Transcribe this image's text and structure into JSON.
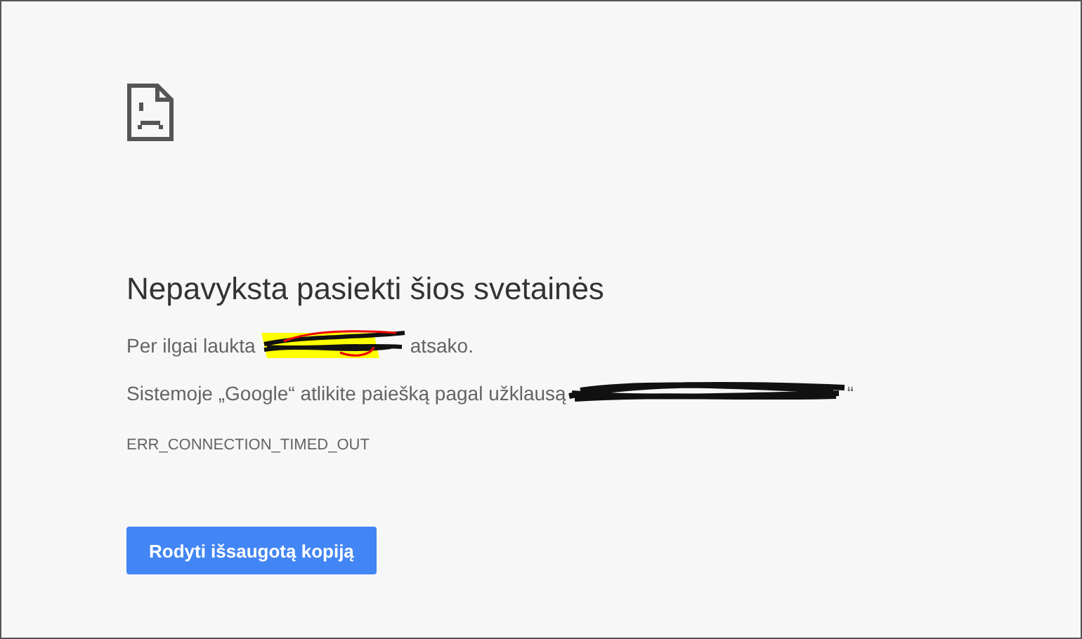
{
  "heading": "Nepavyksta pasiekti šios svetainės",
  "message": {
    "before": "Per ilgai laukta",
    "after": "atsako."
  },
  "suggestion": {
    "text": "Sistemoje „Google“ atlikite paiešką pagal užklausą",
    "after": "“"
  },
  "error_code": "ERR_CONNECTION_TIMED_OUT",
  "button": "Rodyti išsaugotą kopiją"
}
